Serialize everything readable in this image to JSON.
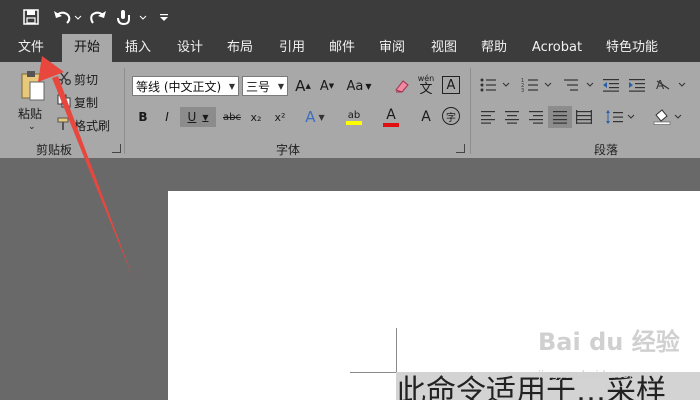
{
  "qat": {
    "icons": [
      "save-icon",
      "undo-icon",
      "redo-icon",
      "touch-icon",
      "customize-icon"
    ]
  },
  "tabs": [
    {
      "label": "文件"
    },
    {
      "label": "开始"
    },
    {
      "label": "插入"
    },
    {
      "label": "设计"
    },
    {
      "label": "布局"
    },
    {
      "label": "引用"
    },
    {
      "label": "邮件"
    },
    {
      "label": "审阅"
    },
    {
      "label": "视图"
    },
    {
      "label": "帮助"
    },
    {
      "label": "Acrobat"
    },
    {
      "label": "特色功能"
    }
  ],
  "clipboard": {
    "group_label": "剪贴板",
    "paste_label": "粘贴",
    "cut_label": "剪切",
    "copy_label": "复制",
    "format_painter_label": "格式刷"
  },
  "font": {
    "group_label": "字体",
    "font_name": "等线 (中文正文)",
    "font_size": "三号",
    "grow_label": "A",
    "shrink_label": "A",
    "case_label": "Aa",
    "phonetic_label": "wén",
    "phonetic_char": "文",
    "border_char": "A",
    "bold_label": "B",
    "italic_label": "I",
    "underline_label": "U",
    "strike_label": "abc",
    "sub_label": "x₂",
    "sup_label": "x²",
    "effects_label": "A",
    "highlight_label": "ab",
    "color_label": "A",
    "shading_label": "A",
    "enclose_label": "字"
  },
  "paragraph": {
    "group_label": "段落"
  },
  "document": {
    "text": "此命令适用于…采样",
    "watermark": "Bai du 经验",
    "watermark_sub": "jingyan.baidu.com"
  },
  "colors": {
    "ribbon": "#a8a8a8",
    "dark": "#3c3c3c",
    "arrow": "#e8473e",
    "highlight": "#ffff00",
    "font_red": "#e01010"
  }
}
